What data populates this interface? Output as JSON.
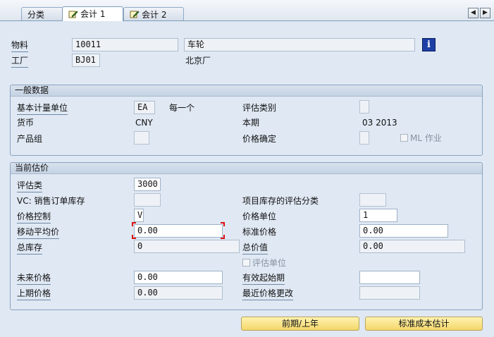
{
  "tabs": [
    {
      "label": "分类",
      "active": false
    },
    {
      "label": "会计 1",
      "active": true
    },
    {
      "label": "会计 2",
      "active": false
    }
  ],
  "nav": {
    "prev": "◀",
    "next": "▶"
  },
  "header": {
    "material_label": "物料",
    "material_value": "10011",
    "material_desc": "车轮",
    "plant_label": "工厂",
    "plant_value": "BJ01",
    "plant_desc": "北京厂",
    "info_icon": "i"
  },
  "general": {
    "title": "一般数据",
    "base_uom_label": "基本计量单位",
    "base_uom_value": "EA",
    "base_uom_desc": "每一个",
    "val_category_label": "评估类别",
    "val_category_value": "",
    "currency_label": "货币",
    "currency_value": "CNY",
    "period_label": "本期",
    "period_value": "03 2013",
    "product_group_label": "产品组",
    "product_group_value": "",
    "price_determination_label": "价格确定",
    "price_determination_value": "",
    "ml_label": "ML 作业"
  },
  "valuation": {
    "title": "当前估价",
    "val_class_label": "评估类",
    "val_class_value": "3000",
    "vc_label": "VC: 销售订单库存",
    "vc_value": "",
    "proj_stock_label": "项目库存的评估分类",
    "proj_stock_value": "",
    "price_control_label": "价格控制",
    "price_control_value": "V",
    "price_unit_label": "价格单位",
    "price_unit_value": "1",
    "mov_avg_label": "移动平均价",
    "mov_avg_value": "0.00",
    "std_price_label": "标准价格",
    "std_price_value": "0.00",
    "total_stock_label": "总库存",
    "total_stock_value": "0",
    "total_value_label": "总价值",
    "total_value_value": "0.00",
    "val_unit_label": "评估单位",
    "future_price_label": "未来价格",
    "future_price_value": "0.00",
    "valid_from_label": "有效起始期",
    "valid_from_value": "",
    "prev_price_label": "上期价格",
    "prev_price_value": "0.00",
    "last_change_label": "最近价格更改",
    "last_change_value": ""
  },
  "buttons": {
    "prev_period": "前期/上年",
    "std_cost_estimate": "标准成本估计"
  },
  "colors": {
    "background": "#dfe8f3",
    "button_fill": "#f4d76a",
    "focus_marker": "#dd1111",
    "info_button": "#1d3fa5"
  }
}
